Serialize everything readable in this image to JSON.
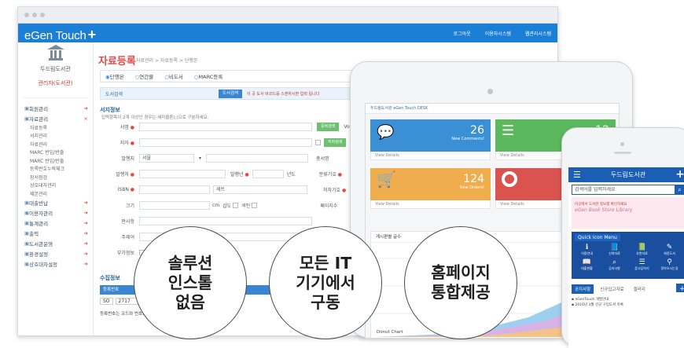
{
  "app": {
    "brand": "eGen Touch",
    "brand_plus": "+"
  },
  "toplinks": [
    "로그아웃",
    "이용자시스템",
    "웹관리시스템"
  ],
  "library": {
    "name": "두드림도서관",
    "user": "관리자(도서관)"
  },
  "sidebar": {
    "sections": [
      {
        "label": "회원관리",
        "open": false
      },
      {
        "label": "자료관리",
        "open": true,
        "items": [
          "자료등록",
          "서지관리",
          "자료관리",
          "MARC 반입/반출",
          "MARC 반입/반출",
          "등록번호누락체크",
          "장서점검",
          "상호대차관리",
          "제본관리"
        ]
      },
      {
        "label": "대출반납",
        "open": false
      },
      {
        "label": "이용자관리",
        "open": false
      },
      {
        "label": "통계관리",
        "open": false
      },
      {
        "label": "출력",
        "open": false
      },
      {
        "label": "도서관운영",
        "open": false
      },
      {
        "label": "환경설정",
        "open": false
      },
      {
        "label": "상호대차설정",
        "open": false
      }
    ]
  },
  "page": {
    "title": "자료등록",
    "crumb": "자료관리 > 자료등록 > 단행본",
    "radios": [
      "단행본",
      "연간물",
      "비도서",
      "MARC등록"
    ],
    "search_label": "도서검색",
    "search_button": "도서검색",
    "search_note": "이 곳 도서 바코드를 스캔하시면 입력 됩니다",
    "bib_section": "서지정보",
    "bib_note": "입력항목이 2개 이상인 경우는 세미콜론(;)으로 구분하세요.",
    "fields": [
      "서명",
      "저자",
      "발행지",
      "발행처",
      "ISBN",
      "크기",
      "판사항",
      "주제어",
      "부가정보"
    ],
    "field_values": {
      "place": "서울",
      "isbn_suffix": "세트",
      "size_unit": "cm"
    },
    "field_extra": {
      "vol": "Vol.",
      "year": "년도",
      "series_label": "총서명",
      "class_label": "분류기호",
      "author_label": "저자기호",
      "page_label": "페이지수",
      "price_label": "가격",
      "page_opts": [
        "삽도",
        "색인"
      ]
    },
    "buttons": {
      "dup_check": "중복검색",
      "author_check": "저자검색"
    },
    "collect_section": "수집정보",
    "reg_label": "등록번호",
    "reg_code": "SO",
    "reg_num": "2717",
    "reg_note": "등록번호는 코드와 번호로 구분됩니다"
  },
  "tablet": {
    "nav": "두드림도서관  eGen Touch DESK",
    "tiles": [
      {
        "num": "26",
        "label": "New Comments!",
        "footer": "View Details",
        "color": "#3b8fd4"
      },
      {
        "num": "12",
        "label": "",
        "footer": "View Details",
        "color": "#5cb85c"
      },
      {
        "num": "124",
        "label": "New Orders!",
        "footer": "View Details",
        "color": "#f0ad4e"
      },
      {
        "num": "",
        "label": "",
        "footer": "View Details",
        "color": "#d9534f"
      }
    ],
    "panel_title": "게시판별 글수",
    "chart_label": "Donut Chart"
  },
  "phone": {
    "title": "두드림도서관",
    "search_placeholder": "검색어를 입력하세요",
    "banner_small": "이곳에서 도서관 정보를 확인하세요",
    "banner_big": "eGen Book Store Library",
    "quick_title": "Quick Icon Menu",
    "quick_items": [
      "이용안내",
      "신착자료",
      "추천자료",
      "희망도서",
      "대출현황",
      "공지사항",
      "묻고답하기",
      "찾아오시는길"
    ],
    "tabs": [
      "공지사항",
      "신규입고자료",
      "갤러리"
    ],
    "list": [
      "eGenTouch 개발안내",
      "2016년 3월 신규 구입도서 목록"
    ]
  },
  "bubbles": [
    "솔루션\n인스톨\n없음",
    "모든 IT\n기기에서\n구동",
    "홈페이지\n통합제공"
  ],
  "colors": {
    "accent": "#1b7fd6",
    "title_red": "#e24a4a",
    "phone_blue": "#1a5fb4"
  }
}
